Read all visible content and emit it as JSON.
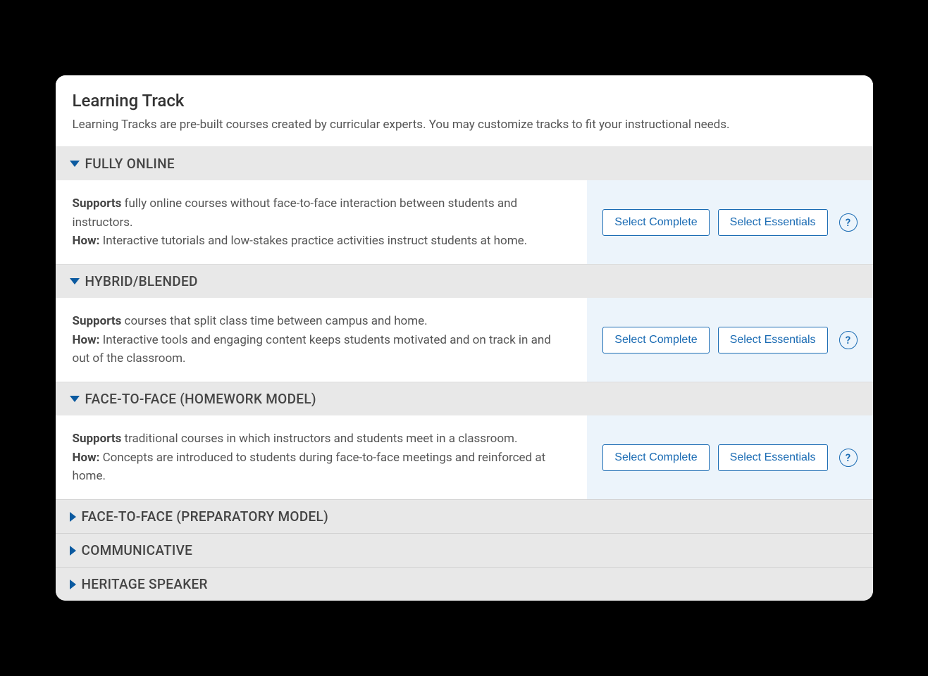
{
  "header": {
    "title": "Learning Track",
    "description": "Learning Tracks are pre-built courses created by curricular experts. You may customize tracks to fit your instructional needs."
  },
  "labels": {
    "supports": "Supports",
    "how": "How:",
    "select_complete": "Select Complete",
    "select_essentials": "Select Essentials",
    "help_symbol": "?"
  },
  "tracks": [
    {
      "id": "fully-online",
      "title": "FULLY ONLINE",
      "expanded": true,
      "supports_text": " fully online courses without face-to-face interaction between students and instructors.",
      "how_text": " Interactive tutorials and low-stakes practice activities instruct students at home."
    },
    {
      "id": "hybrid-blended",
      "title": "HYBRID/BLENDED",
      "expanded": true,
      "supports_text": " courses that split class time between campus and home.",
      "how_text": " Interactive tools and engaging content keeps students motivated and on track in and out of the classroom."
    },
    {
      "id": "face-to-face-homework",
      "title": "FACE-TO-FACE (HOMEWORK MODEL)",
      "expanded": true,
      "supports_text": " traditional courses in which instructors and students meet in a classroom.",
      "how_text": " Concepts are introduced to students during face-to-face meetings and reinforced at home."
    },
    {
      "id": "face-to-face-preparatory",
      "title": "FACE-TO-FACE (PREPARATORY MODEL)",
      "expanded": false
    },
    {
      "id": "communicative",
      "title": "COMMUNICATIVE",
      "expanded": false
    },
    {
      "id": "heritage-speaker",
      "title": "HERITAGE SPEAKER",
      "expanded": false
    }
  ]
}
